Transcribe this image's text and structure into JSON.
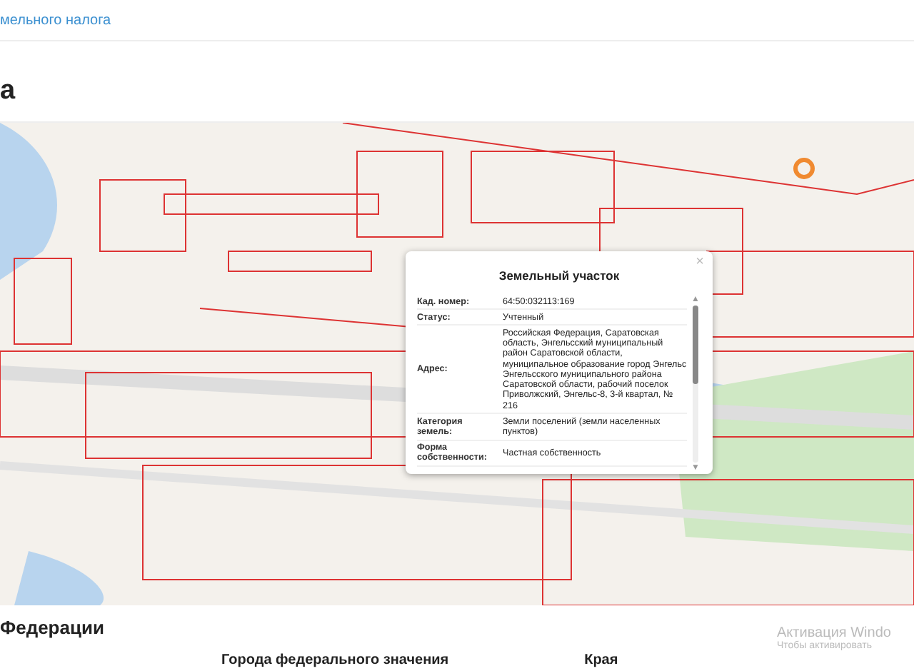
{
  "top_link": "мельного налога",
  "heading": "а",
  "map_popup": {
    "title": "Земельный участок",
    "close": "×",
    "rows": [
      {
        "label": "Кад. номер:",
        "value": "64:50:032113:169"
      },
      {
        "label": "Статус:",
        "value": "Учтенный"
      },
      {
        "label": "Адрес:",
        "value": "Российская Федерация, Саратовская область, Энгельсский муниципальный район Саратовской области, муниципальное образование город Энгельс Энгельсского муниципального района Саратовской области, рабочий поселок Приволжский, Энгельс-8, 3-й квартал, № 216"
      },
      {
        "label": "Категория земель:",
        "value": "Земли поселений (земли населенных пунктов)"
      },
      {
        "label": "Форма собственности:",
        "value": "Частная собственность"
      }
    ],
    "scroll_up": "▲",
    "scroll_down": "▼",
    "level": 0.5
  },
  "section_heading": "Федерации",
  "columns": [
    "Города федерального значения",
    "Края"
  ],
  "os_notice": {
    "title": "Активация Windo",
    "subtitle": "Чтобы активировать"
  }
}
